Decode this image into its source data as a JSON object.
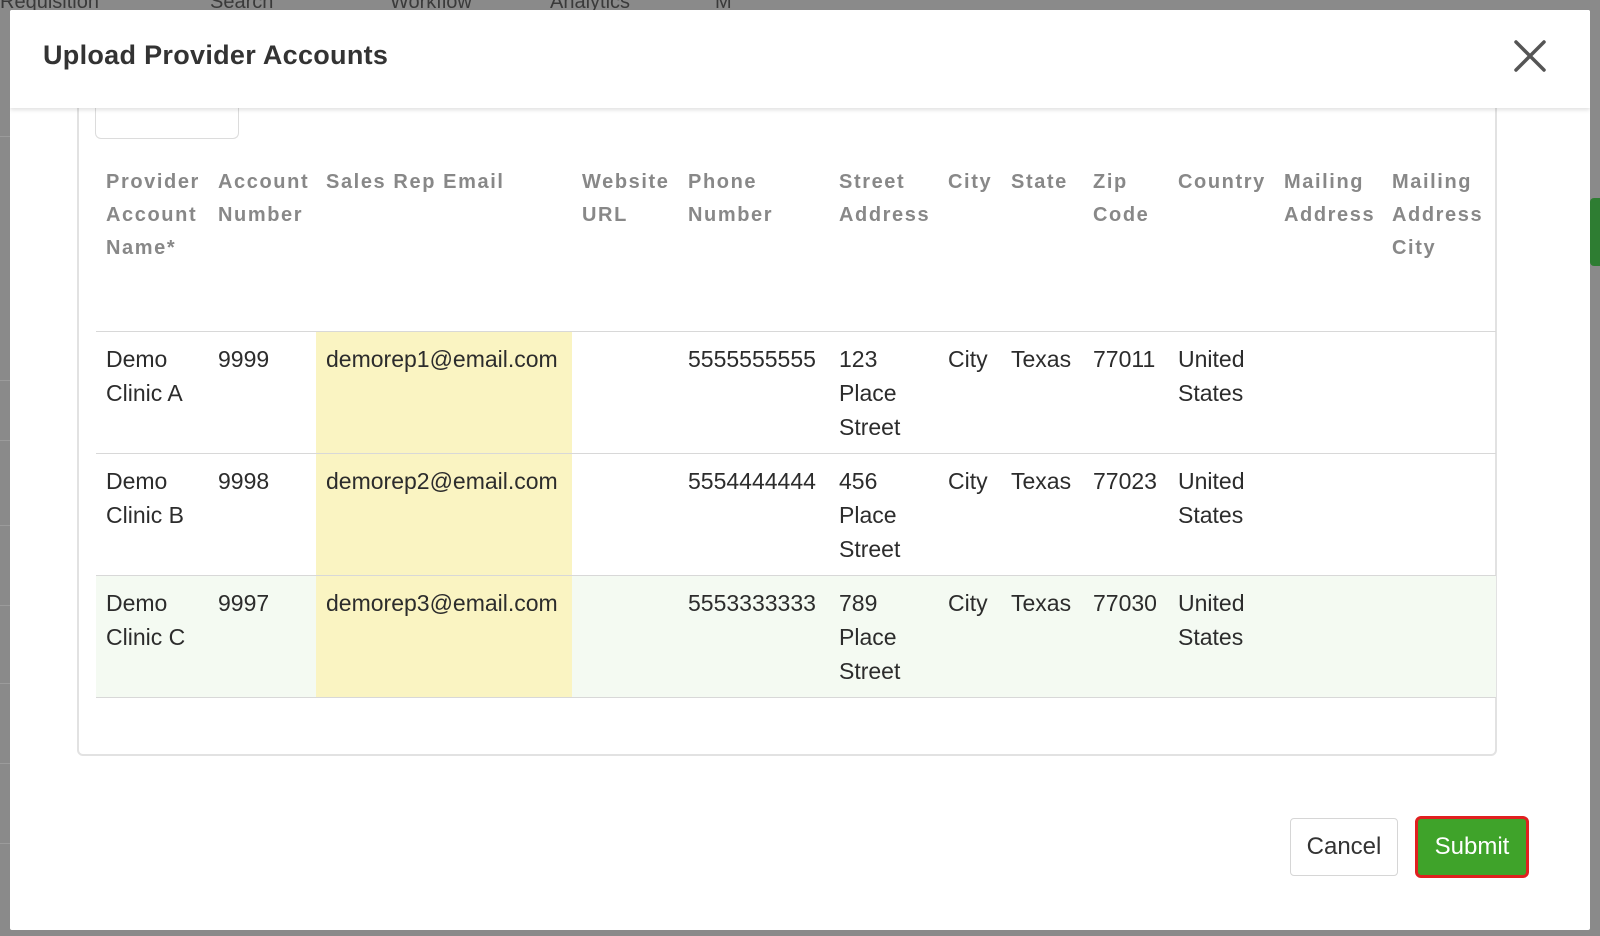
{
  "background": {
    "nav_items": [
      "Requisition",
      "Search",
      "Workflow",
      "Analytics",
      "M"
    ],
    "accent": "#2e7d32"
  },
  "modal": {
    "title": "Upload Provider Accounts",
    "close_icon": "close-icon",
    "table": {
      "columns": [
        "Provider Account Name*",
        "Account Number",
        "Sales Rep Email",
        "Website URL",
        "Phone Number",
        "Street Address",
        "City",
        "State",
        "Zip Code",
        "Country",
        "Mailing Address",
        "Mailing Address City"
      ],
      "rows": [
        {
          "name": "Demo Clinic A",
          "account": "9999",
          "email": "demorep1@email.com",
          "website": "",
          "phone": "5555555555",
          "street": "123 Place Street",
          "city": "City",
          "state": "Texas",
          "zip": "77011",
          "country": "United States",
          "mailing": "",
          "mailing_city": ""
        },
        {
          "name": "Demo Clinic B",
          "account": "9998",
          "email": "demorep2@email.com",
          "website": "",
          "phone": "5554444444",
          "street": "456 Place Street",
          "city": "City",
          "state": "Texas",
          "zip": "77023",
          "country": "United States",
          "mailing": "",
          "mailing_city": ""
        },
        {
          "name": "Demo Clinic C",
          "account": "9997",
          "email": "demorep3@email.com",
          "website": "",
          "phone": "5553333333",
          "street": "789 Place Street",
          "city": "City",
          "state": "Texas",
          "zip": "77030",
          "country": "United States",
          "mailing": "",
          "mailing_city": ""
        }
      ],
      "highlight_color": "#faf4c2"
    },
    "buttons": {
      "cancel_label": "Cancel",
      "submit_label": "Submit"
    },
    "colors": {
      "submit": "#3fa32a",
      "submit_outline": "#e02020"
    }
  }
}
